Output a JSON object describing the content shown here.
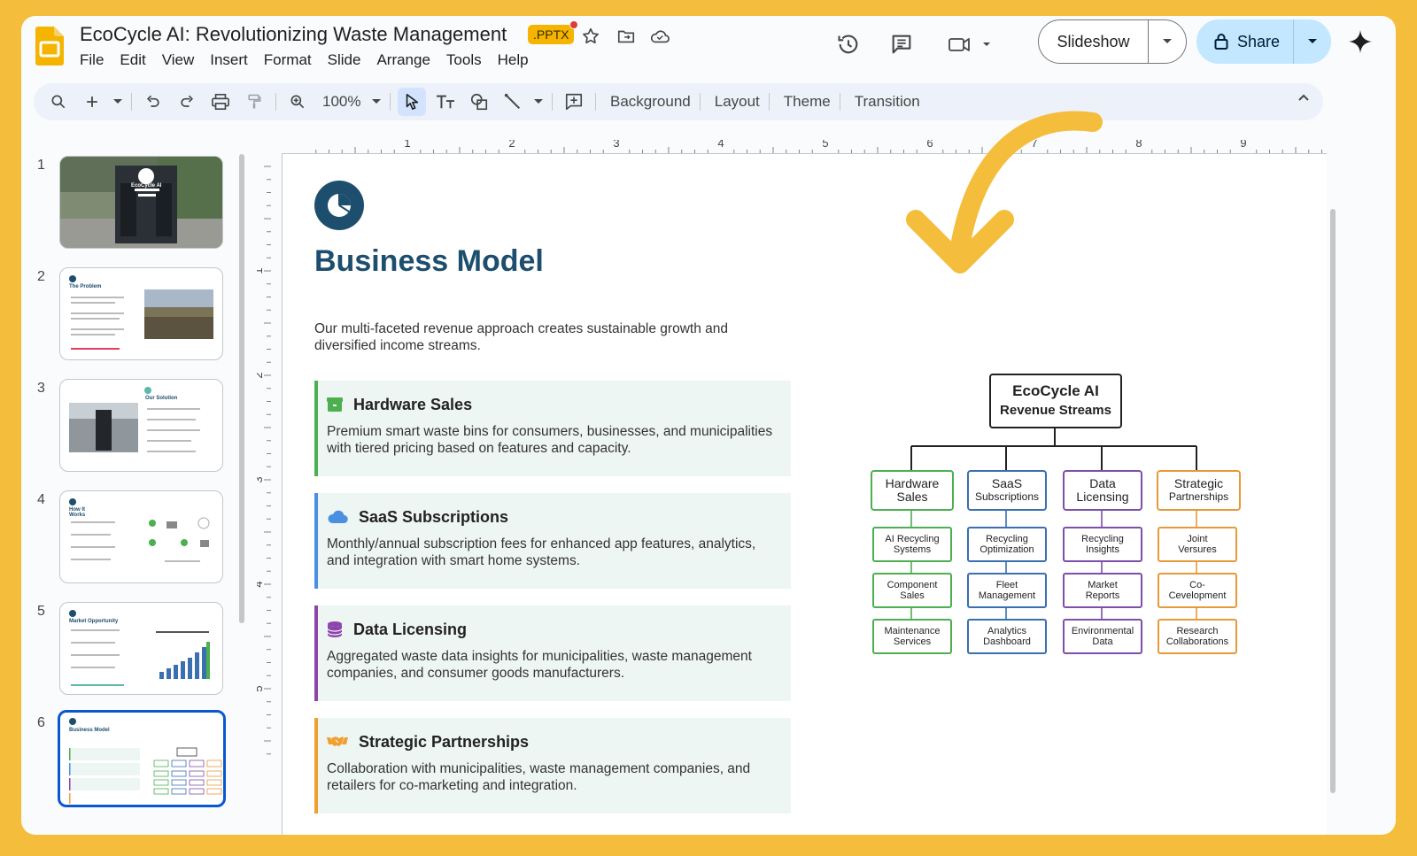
{
  "app": {
    "doc_title": "EcoCycle AI: Revolutionizing Waste Management",
    "file_badge": ".PPTX",
    "menu": [
      "File",
      "Edit",
      "View",
      "Insert",
      "Format",
      "Slide",
      "Arrange",
      "Tools",
      "Help"
    ],
    "slideshow_label": "Slideshow",
    "share_label": "Share"
  },
  "toolbar": {
    "zoom": "100%",
    "background_label": "Background",
    "layout_label": "Layout",
    "theme_label": "Theme",
    "transition_label": "Transition"
  },
  "rulers": {
    "top_ticks": [
      "1",
      "2",
      "3",
      "4",
      "5",
      "6",
      "7",
      "8",
      "9"
    ],
    "left_ticks": [
      "1",
      "2",
      "3",
      "4",
      "5"
    ]
  },
  "filmstrip": {
    "slides": [
      {
        "number": "1",
        "title": "EcoCycle AI"
      },
      {
        "number": "2",
        "title": "The Problem"
      },
      {
        "number": "3",
        "title": "Our Solution"
      },
      {
        "number": "4",
        "title": "How It Works"
      },
      {
        "number": "5",
        "title": "Market Opportunity"
      },
      {
        "number": "6",
        "title": "Business Model"
      }
    ],
    "selected_index": 5
  },
  "slide": {
    "title": "Business Model",
    "intro": "Our multi-faceted revenue approach creates sustainable growth and diversified income streams.",
    "cards": [
      {
        "title": "Hardware Sales",
        "desc": "Premium smart waste bins for consumers, businesses, and municipalities with tiered pricing based on features and capacity.",
        "color": "#4caf50",
        "icon": "box-icon"
      },
      {
        "title": "SaaS Subscriptions",
        "desc": "Monthly/annual subscription fees for enhanced app features, analytics, and integration with smart home systems.",
        "color": "#4a90e2",
        "icon": "cloud-icon"
      },
      {
        "title": "Data Licensing",
        "desc": "Aggregated waste data insights for municipalities, waste management companies, and consumer goods manufacturers.",
        "color": "#8e44ad",
        "icon": "database-icon"
      },
      {
        "title": "Strategic Partnerships",
        "desc": "Collaboration with municipalities, waste management companies, and retailers for co-marketing and integration.",
        "color": "#f0a030",
        "icon": "handshake-icon"
      }
    ],
    "org_chart": {
      "root_line1": "EcoCycle AI",
      "root_line2": "Revenue Streams",
      "branches": [
        {
          "line1": "Hardware",
          "line2": "Sales",
          "color": "#4caf50",
          "leaves": [
            [
              "AI Recycling",
              "Systems"
            ],
            [
              "Component",
              "Sales"
            ],
            [
              "Maintenance",
              "Services"
            ]
          ]
        },
        {
          "line1": "SaaS",
          "line2": "Subscriptions",
          "color": "#3a6fb0",
          "leaves": [
            [
              "Recycling",
              "Optimization"
            ],
            [
              "Fleet",
              "Management"
            ],
            [
              "Analytics",
              "Dashboard"
            ]
          ]
        },
        {
          "line1": "Data",
          "line2": "Licensing",
          "color": "#7d4fa8",
          "leaves": [
            [
              "Recycling",
              "Insights"
            ],
            [
              "Market",
              "Reports"
            ],
            [
              "Environmental",
              "Data"
            ]
          ]
        },
        {
          "line1": "Strategic",
          "line2": "Partnerships",
          "color": "#e69a3a",
          "leaves": [
            [
              "Joint",
              "Versures"
            ],
            [
              "Co-",
              "Cevelopment"
            ],
            [
              "Research",
              "Collaborations"
            ]
          ]
        }
      ]
    }
  },
  "colors": {
    "frame": "#f5bd3c",
    "slide_title": "#1d4e6e",
    "selection": "#0b57d0",
    "share_bg": "#c2e7ff",
    "annotation_arrow": "#f5bd3c"
  }
}
